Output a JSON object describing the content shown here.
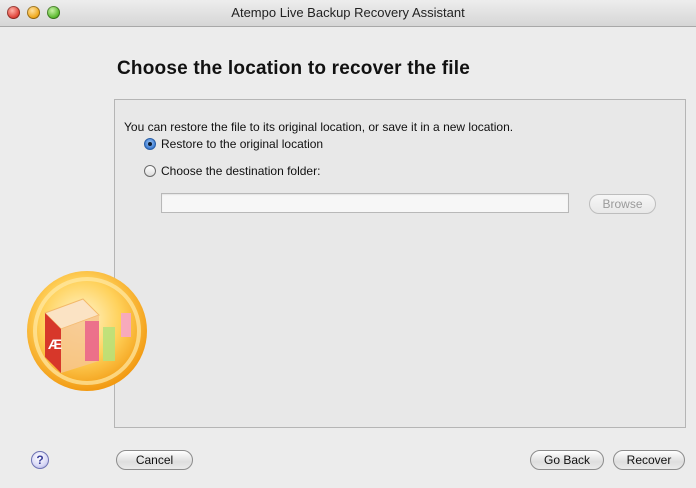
{
  "window": {
    "title": "Atempo Live Backup Recovery Assistant"
  },
  "page": {
    "heading": "Choose the location to recover the file",
    "intro": "You can restore the file to its original location, or save it in a new location."
  },
  "options": [
    {
      "label": "Restore to the original location",
      "checked": true
    },
    {
      "label": "Choose the destination folder:",
      "checked": false
    }
  ],
  "destination": {
    "value": "",
    "browse_label": "Browse"
  },
  "footer": {
    "help_label": "?",
    "cancel_label": "Cancel",
    "back_label": "Go Back",
    "recover_label": "Recover"
  },
  "colors": {
    "logo_orange": "#f5a623",
    "logo_red": "#d7372a"
  }
}
